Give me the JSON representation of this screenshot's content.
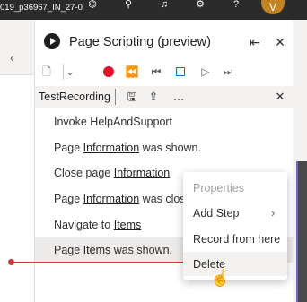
{
  "window": {
    "environment_label": "019_p36967_IN_27-0",
    "avatar_initial": "V",
    "top_icons": [
      "copilot-icon",
      "search-icon",
      "bell-icon",
      "gear-icon",
      "help-icon"
    ]
  },
  "panel": {
    "title": "Page Scripting (preview)",
    "toolbar_icons": [
      "new-script-icon",
      "chevron-down-icon",
      "record-icon",
      "rewind-icon",
      "step-back-icon",
      "stop-icon",
      "play-icon",
      "step-forward-icon"
    ],
    "recording_name": "TestRecording",
    "steps": [
      {
        "prefix": "Invoke HelpAndSupport",
        "link": "",
        "suffix": ""
      },
      {
        "prefix": "Page ",
        "link": "Information",
        "suffix": " was shown."
      },
      {
        "prefix": "Close page ",
        "link": "Information",
        "suffix": ""
      },
      {
        "prefix": "Page ",
        "link": "Information",
        "suffix": " was closed."
      },
      {
        "prefix": "Navigate to ",
        "link": "Items",
        "suffix": ""
      },
      {
        "prefix": "Page ",
        "link": "Items",
        "suffix": " was shown."
      }
    ]
  },
  "context_menu": {
    "items": [
      {
        "label": "Properties",
        "disabled": true
      },
      {
        "label": "Add Step",
        "submenu": true
      },
      {
        "label": "Record from here"
      },
      {
        "label": "Delete"
      }
    ]
  },
  "colors": {
    "record": "#e81123",
    "insertion_line": "#d13438",
    "accent": "#0078d4"
  }
}
